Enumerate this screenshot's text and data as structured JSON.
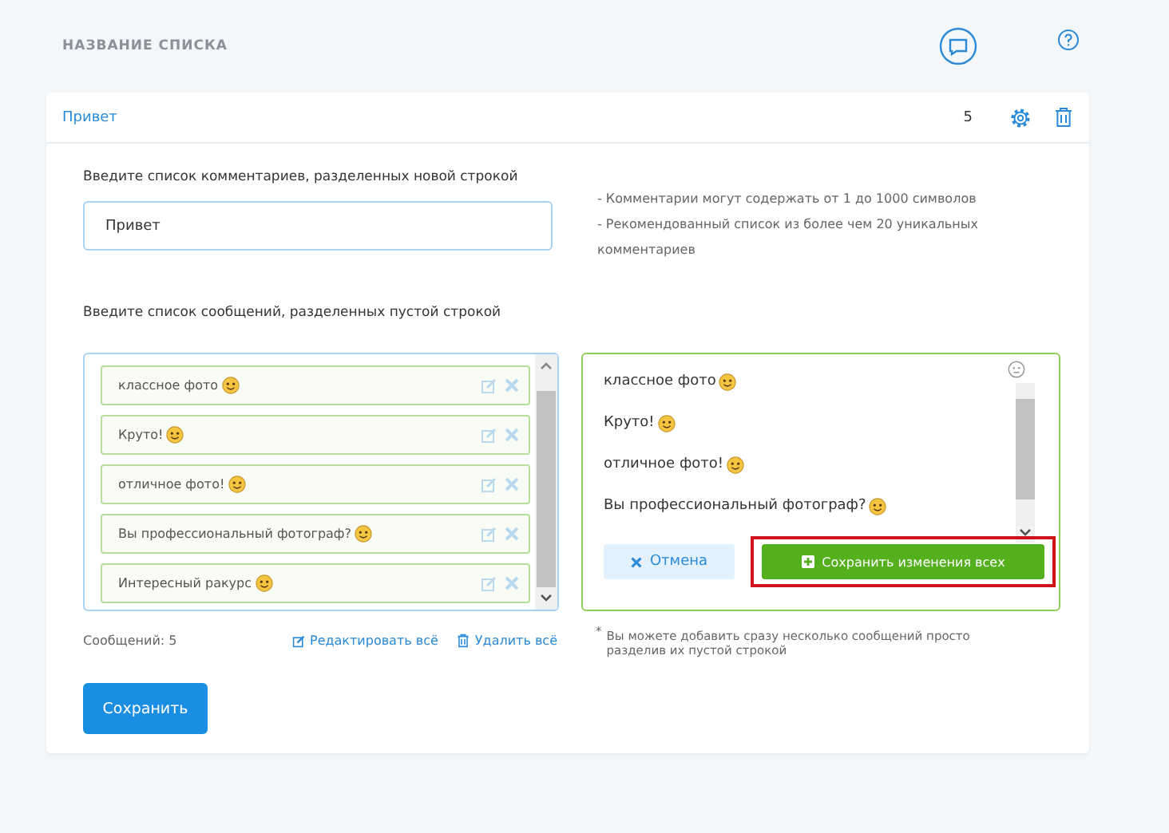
{
  "header": {
    "title": "НАЗВАНИЕ СПИСКА"
  },
  "list": {
    "name": "Привет",
    "count": "5"
  },
  "comments": {
    "label": "Введите список комментариев, разделенных новой строкой",
    "value": "Привет",
    "hints": [
      "- Комментарии могут содержать от 1 до 1000 символов",
      "- Рекомендованный список из более чем 20 уникальных комментариев"
    ]
  },
  "messages": {
    "label": "Введите список сообщений, разделенных пустой строкой",
    "items": [
      {
        "text": "классное фото "
      },
      {
        "text": "Круто!"
      },
      {
        "text": "отличное фото!"
      },
      {
        "text": "Вы профессиональный фотограф?"
      },
      {
        "text": "Интересный ракурс"
      }
    ],
    "editor_lines": [
      {
        "text": "классное фото "
      },
      {
        "text": "Круто!"
      },
      {
        "text": "отличное фото!"
      },
      {
        "text": "Вы профессиональный фотограф?"
      }
    ],
    "cancel": "Отмена",
    "save_all": "Сохранить изменения всех",
    "save_all_highlighted": true,
    "count_label": "Сообщений: 5",
    "edit_all": "Редактировать всё",
    "delete_all": "Удалить всё",
    "note_mark": "*",
    "note": "Вы можете добавить сразу несколько сообщений просто разделив их пустой строкой"
  },
  "save": "Сохранить"
}
